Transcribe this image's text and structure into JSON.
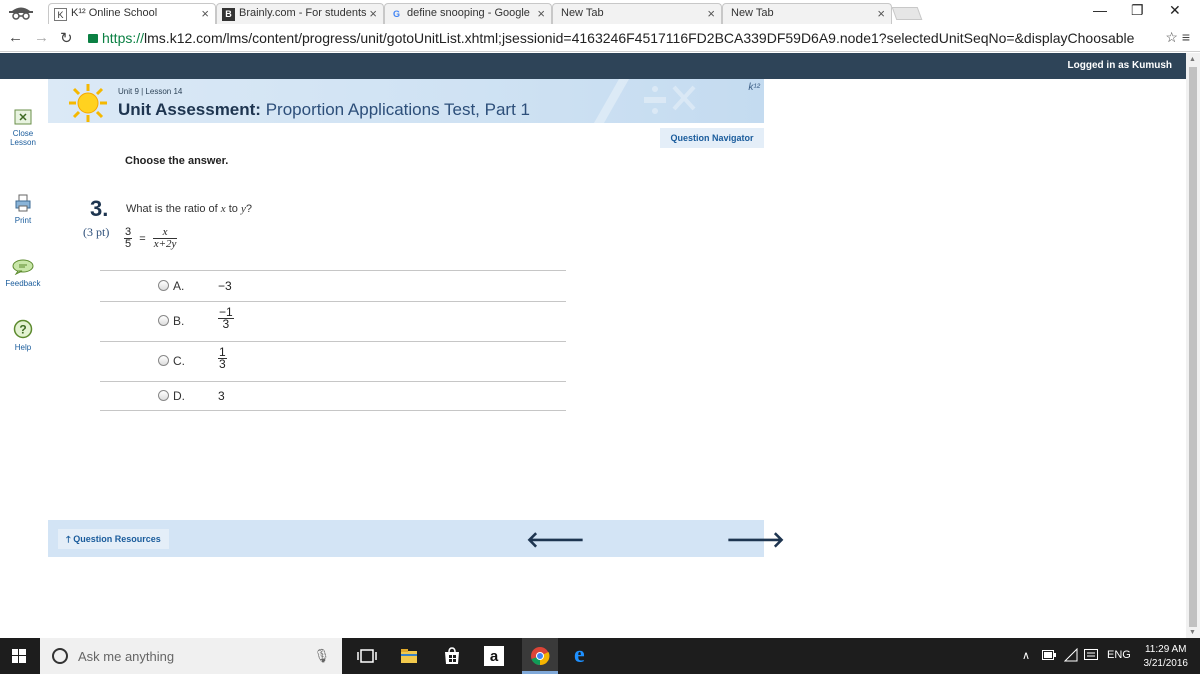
{
  "browser": {
    "tabs": [
      {
        "title": "K¹² Online School",
        "favicon": "k12-favicon"
      },
      {
        "title": "Brainly.com - For students",
        "favicon": "brainly-favicon"
      },
      {
        "title": "define snooping - Google",
        "favicon": "google-favicon"
      },
      {
        "title": "New Tab",
        "favicon": ""
      },
      {
        "title": "New Tab",
        "favicon": ""
      }
    ],
    "url_scheme": "https://",
    "url_rest": "lms.k12.com/lms/content/progress/unit/gotoUnitList.xhtml;jsessionid=4163246F4517116FD2BCA339DF59D6A9.node1?selectedUnitSeqNo=&displayChoosable"
  },
  "k12": {
    "logged_in": "Logged in as Kumush",
    "sidebar": {
      "close": "Close Lesson",
      "print": "Print",
      "feedback": "Feedback",
      "help": "Help"
    },
    "header": {
      "lesson": "Unit 9 | Lesson 14",
      "title_bold": "Unit Assessment:",
      "title_rest": "Proportion Applications Test, Part 1",
      "logo": "k¹²"
    },
    "question_navigator": "Question Navigator",
    "instruction": "Choose the answer.",
    "question": {
      "number": "3.",
      "text_before": "What is the ratio of ",
      "var_x": "x",
      "text_mid": " to ",
      "var_y": "y",
      "text_after": "?",
      "points": "(3 pt)",
      "eq_left_num": "3",
      "eq_left_den": "5",
      "eq_sign": "=",
      "eq_right_num": "x",
      "eq_right_den": "x+2y"
    },
    "choices": [
      {
        "letter": "A.",
        "value": "−3",
        "type": "plain"
      },
      {
        "letter": "B.",
        "num": "−1",
        "den": "3",
        "type": "frac"
      },
      {
        "letter": "C.",
        "num": "1",
        "den": "3",
        "type": "frac"
      },
      {
        "letter": "D.",
        "value": "3",
        "type": "plain"
      }
    ],
    "question_resources": "Question Resources"
  },
  "taskbar": {
    "search_placeholder": "Ask me anything",
    "language": "ENG",
    "time": "11:29 AM",
    "date": "3/21/2016"
  }
}
